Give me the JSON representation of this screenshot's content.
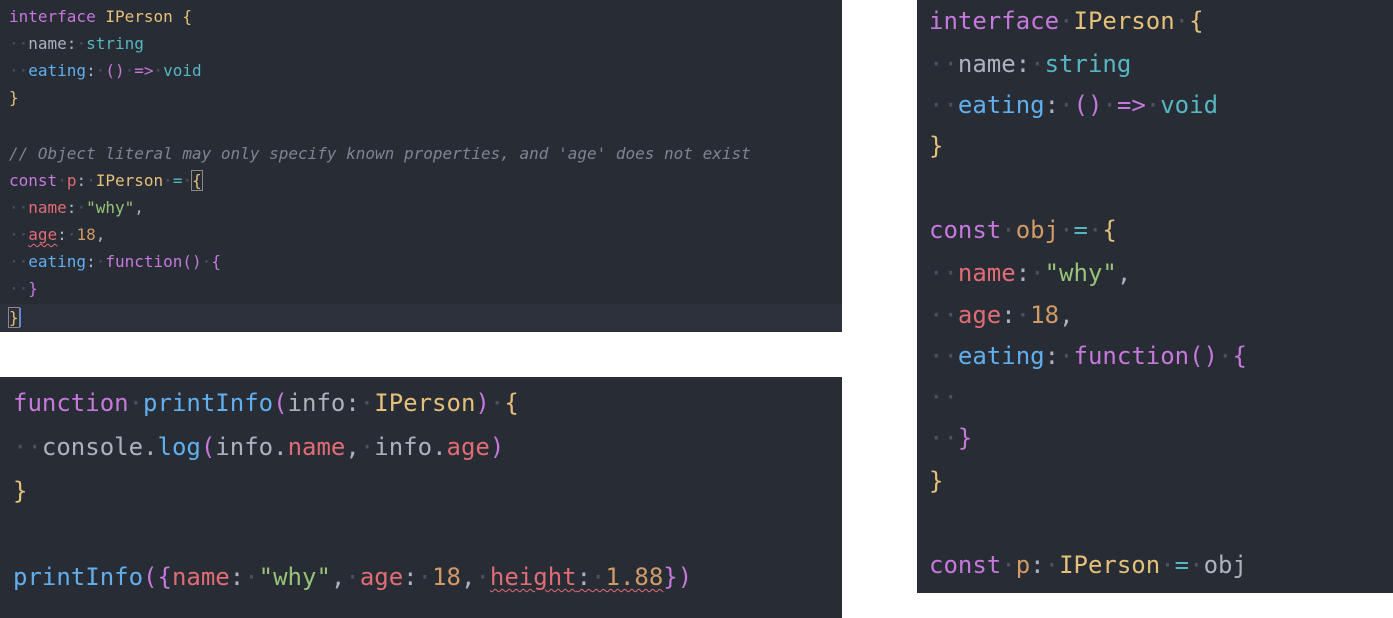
{
  "panel_top": {
    "line1": {
      "kw": "interface",
      "type": "IPerson",
      "brace": "{"
    },
    "line2": {
      "prop": "name",
      "colon": ":",
      "type": "string"
    },
    "line3": {
      "prop": "eating",
      "colon": ":",
      "sig": "()",
      "arrow": "=>",
      "ret": "void"
    },
    "line4": {
      "brace": "}"
    },
    "comment": "// Object literal may only specify known properties, and 'age' does not exist",
    "line6": {
      "kw": "const",
      "name": "p",
      "colon": ":",
      "type": "IPerson",
      "eq": "=",
      "brace": "{"
    },
    "line7": {
      "prop": "name",
      "colon": ":",
      "value": "\"why\"",
      "comma": ","
    },
    "line8": {
      "prop": "age",
      "colon": ":",
      "value": "18",
      "comma": ","
    },
    "line9": {
      "prop": "eating",
      "colon": ":",
      "kw": "function",
      "paren": "()",
      "brace": "{"
    },
    "line10": {
      "brace": "}"
    },
    "line11": {
      "brace": "}"
    }
  },
  "panel_bottom": {
    "line1": {
      "kw": "function",
      "fn": "printInfo",
      "open": "(",
      "param": "info",
      "colon": ":",
      "type": "IPerson",
      "close": ")",
      "brace": "{"
    },
    "line2": {
      "obj": "console",
      "dot": ".",
      "method": "log",
      "open": "(",
      "a1": "info",
      "dot2": ".",
      "p1": "name",
      "comma": ",",
      "a2": "info",
      "dot3": ".",
      "p2": "age",
      "close": ")"
    },
    "line3": {
      "brace": "}"
    },
    "line5": {
      "fn": "printInfo",
      "open": "({",
      "k1": "name",
      "v1": "\"why\"",
      "k2": "age",
      "v2": "18",
      "k3": "height",
      "v3": "1.88",
      "close": "})",
      "colon": ":",
      "comma": ","
    }
  },
  "panel_right": {
    "line1": {
      "kw": "interface",
      "type": "IPerson",
      "brace": "{"
    },
    "line2": {
      "prop": "name",
      "colon": ":",
      "type": "string"
    },
    "line3": {
      "prop": "eating",
      "colon": ":",
      "sig": "()",
      "arrow": "=>",
      "ret": "void"
    },
    "line4": {
      "brace": "}"
    },
    "line6": {
      "kw": "const",
      "name": "obj",
      "eq": "=",
      "brace": "{"
    },
    "line7": {
      "prop": "name",
      "colon": ":",
      "value": "\"why\"",
      "comma": ","
    },
    "line8": {
      "prop": "age",
      "colon": ":",
      "value": "18",
      "comma": ","
    },
    "line9": {
      "prop": "eating",
      "colon": ":",
      "kw": "function",
      "paren": "()",
      "brace": "{"
    },
    "line11": {
      "brace": "}"
    },
    "line12": {
      "brace": "}"
    },
    "line14": {
      "kw": "const",
      "name": "p",
      "colon": ":",
      "type": "IPerson",
      "eq": "=",
      "value": "obj"
    }
  },
  "colors": {
    "background": "#282c34",
    "keyword": "#c678dd",
    "type": "#e5c07b",
    "property": "#e06c75",
    "string": "#98c379",
    "number": "#d19a66",
    "function": "#61afef",
    "comment": "#7f848e",
    "error": "#e06c75"
  }
}
